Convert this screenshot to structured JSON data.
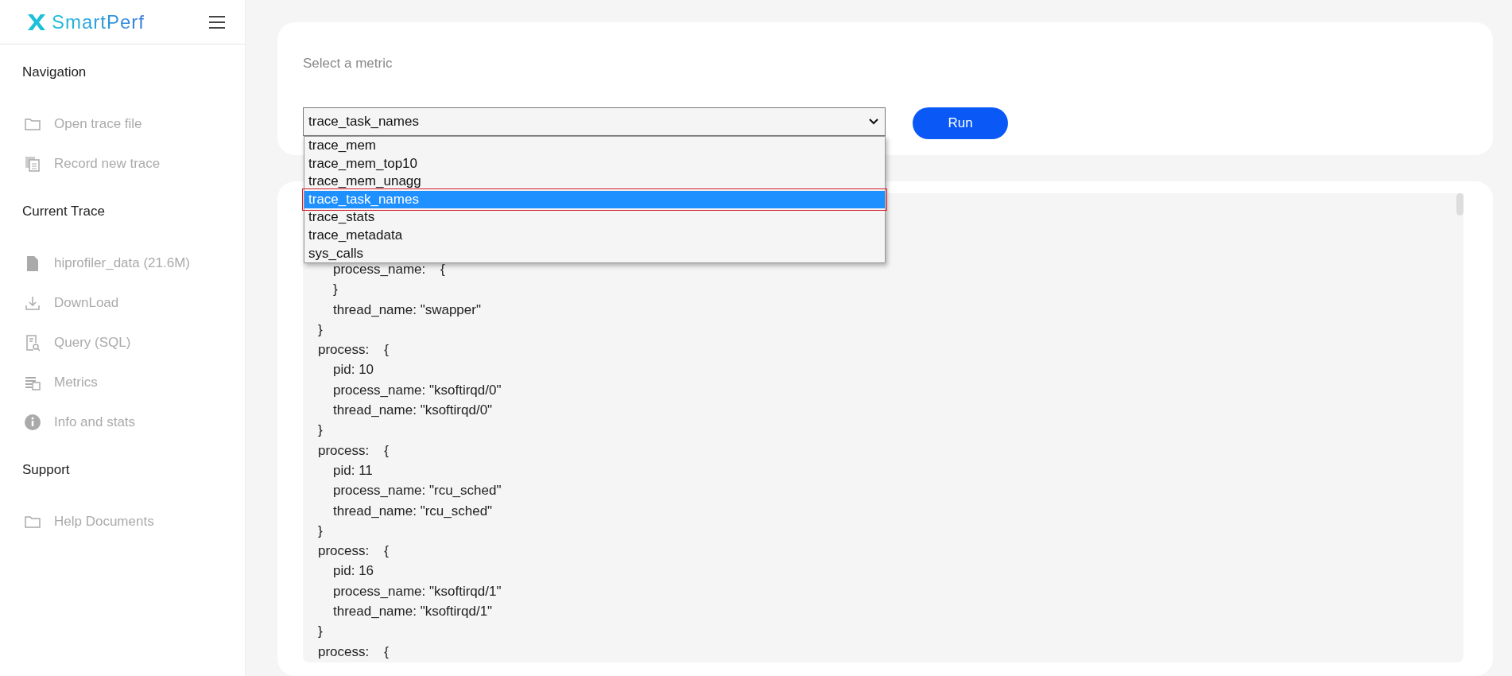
{
  "sidebar": {
    "logo": "SmartPerf",
    "sections": [
      {
        "title": "Navigation",
        "items": [
          {
            "label": "Open trace file",
            "kind": "folder",
            "disabled": true
          },
          {
            "label": "Record new trace",
            "kind": "copy",
            "disabled": true
          }
        ]
      },
      {
        "title": "Current Trace",
        "items": [
          {
            "label": "hiprofiler_data (21.6M)",
            "kind": "file",
            "disabled": true
          },
          {
            "label": "DownLoad",
            "kind": "download",
            "disabled": true
          },
          {
            "label": "Query (SQL)",
            "kind": "query",
            "disabled": true
          },
          {
            "label": "Metrics",
            "kind": "metrics",
            "disabled": true
          },
          {
            "label": "Info and stats",
            "kind": "info",
            "disabled": true
          }
        ]
      },
      {
        "title": "Support",
        "items": [
          {
            "label": "Help Documents",
            "kind": "folder",
            "disabled": true
          }
        ]
      }
    ]
  },
  "metric": {
    "label": "Select a metric",
    "value": "trace_task_names",
    "run": "Run",
    "options": [
      {
        "label": "trace_mem",
        "selected": false,
        "highlighted": false
      },
      {
        "label": "trace_mem_top10",
        "selected": false,
        "highlighted": false
      },
      {
        "label": "trace_mem_unagg",
        "selected": false,
        "highlighted": false
      },
      {
        "label": "trace_task_names",
        "selected": true,
        "highlighted": true
      },
      {
        "label": "trace_stats",
        "selected": false,
        "highlighted": false
      },
      {
        "label": "trace_metadata",
        "selected": false,
        "highlighted": false
      },
      {
        "label": "sys_calls",
        "selected": false,
        "highlighted": false
      }
    ]
  },
  "output": {
    "lines": [
      {
        "children": [
          {
            "text": "process_name:    {"
          },
          {
            "text": "}"
          },
          {
            "text": "thread_name: \"swapper\""
          }
        ]
      },
      {
        "text": "}"
      },
      {
        "text": "process:    {",
        "children": [
          {
            "text": "pid: 10"
          },
          {
            "text": "process_name: \"ksoftirqd/0\""
          },
          {
            "text": "thread_name: \"ksoftirqd/0\""
          }
        ]
      },
      {
        "text": "}"
      },
      {
        "text": "process:    {",
        "children": [
          {
            "text": "pid: 11"
          },
          {
            "text": "process_name: \"rcu_sched\""
          },
          {
            "text": "thread_name: \"rcu_sched\""
          }
        ]
      },
      {
        "text": "}"
      },
      {
        "text": "process:    {",
        "children": [
          {
            "text": "pid: 16"
          },
          {
            "text": "process_name: \"ksoftirqd/1\""
          },
          {
            "text": "thread_name: \"ksoftirqd/1\""
          }
        ]
      },
      {
        "text": "}"
      },
      {
        "text": "process:    {"
      }
    ]
  }
}
